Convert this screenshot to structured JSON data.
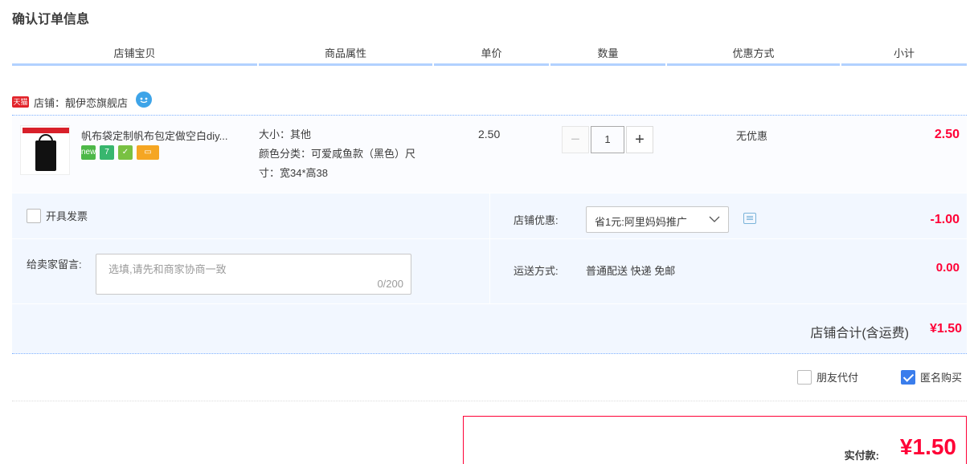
{
  "page": {
    "title": "确认订单信息"
  },
  "table_header": [
    "店铺宝贝",
    "商品属性",
    "单价",
    "数量",
    "优惠方式",
    "小计"
  ],
  "shop": {
    "platform_badge": "天猫",
    "label": "店铺：靓伊恋旗舰店"
  },
  "item": {
    "name": "帆布袋定制帆布包定做空白diy...",
    "attr_lines": [
      "大小：其他",
      "颜色分类：可爱咸鱼款（黑色）尺",
      "寸：宽34*高38"
    ],
    "price": "2.50",
    "quantity": "1",
    "minus": "−",
    "plus": "+",
    "discount": "无优惠",
    "subtotal": "2.50"
  },
  "invoice": {
    "label": "开具发票"
  },
  "message": {
    "label": "给卖家留言:",
    "placeholder": "选填,请先和商家协商一致",
    "counter": "0/200"
  },
  "shop_discount": {
    "label": "店铺优惠:",
    "selected": "省1元:阿里妈妈推广",
    "amount": "-1.00"
  },
  "shipping": {
    "label": "运送方式:",
    "value": "普通配送 快递 免邮",
    "amount": "0.00"
  },
  "shop_total": {
    "label": "店铺合计(含运费)",
    "amount": "¥1.50"
  },
  "pay_options": {
    "friend_pay": "朋友代付",
    "anonymous": "匿名购买",
    "anonymous_checked": true
  },
  "actual_payment": {
    "label": "实付款:",
    "amount": "¥1.50"
  },
  "colors": {
    "price_red": "#ff0036",
    "header_blue": "#b2d1ff",
    "panel_bg": "#f2f7ff",
    "check_blue": "#3a7dec"
  }
}
